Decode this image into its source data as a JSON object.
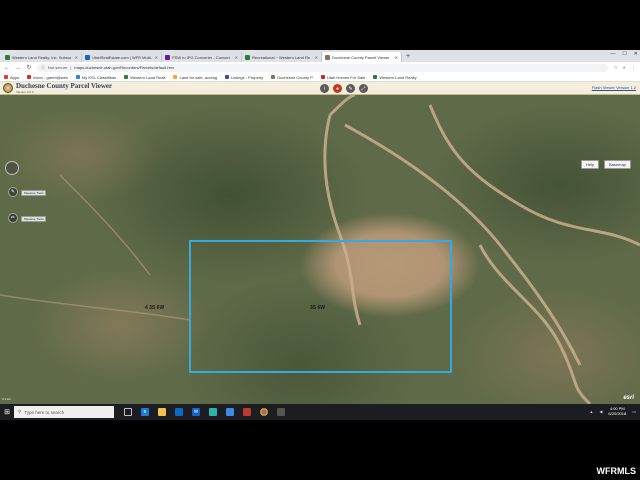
{
  "browser": {
    "tabs": [
      {
        "title": "Western Land Realty, Inc. Subsur",
        "color": "#2e7d32",
        "active": false
      },
      {
        "title": "UtahRealEstate.com | WFR Multi-",
        "color": "#1565c0",
        "active": false
      },
      {
        "title": "PSW to IPG Converter - Convert",
        "color": "#6a1b9a",
        "active": false
      },
      {
        "title": "Recreational ~ Western Land Re",
        "color": "#2e7d32",
        "active": false
      },
      {
        "title": "Duchesne County Parcel Viewer",
        "color": "#8d6e63",
        "active": true
      }
    ],
    "new_tab": "+",
    "url_secure": "Not secure",
    "url": "maps.duchesne.utah.gov/Recorders/Parcels/default.htm",
    "bookmarks": [
      {
        "label": "Apps",
        "color": "#e53935"
      },
      {
        "label": "Inbox - garett@wes",
        "color": "#d93025"
      },
      {
        "label": "My KSL Classifieds",
        "color": "#1e88e5"
      },
      {
        "label": "Western Land Realt",
        "color": "#2e7d32"
      },
      {
        "label": "Land for sale, acreag",
        "color": "#f9a825"
      },
      {
        "label": "Listings - Property",
        "color": "#3949ab"
      },
      {
        "label": "Duchesne County P",
        "color": "#8d6e63"
      },
      {
        "label": "Utah Homes For Sale",
        "color": "#c62828"
      },
      {
        "label": "Western Land Realty",
        "color": "#2e7d32"
      }
    ]
  },
  "app": {
    "title": "Duchesne County Parcel Viewer",
    "version": "Version 2.0.0",
    "link": "Flash Viewer Version 1.2",
    "tools": [
      "i",
      "●",
      "✎",
      "⤢"
    ]
  },
  "map": {
    "buttons": {
      "help": "Help",
      "basemap": "Basemap"
    },
    "tool_tags": [
      "Measure Tools",
      "Measure Tools"
    ],
    "labels": {
      "left": "4 3S 6W",
      "center": "3S 6W"
    },
    "attribution": "esri",
    "scale": "0       1 km"
  },
  "taskbar": {
    "search_placeholder": "Type here to search",
    "clock_time": "4:00 PM",
    "clock_date": "6/20/2018"
  },
  "watermark": "WFRMLS"
}
